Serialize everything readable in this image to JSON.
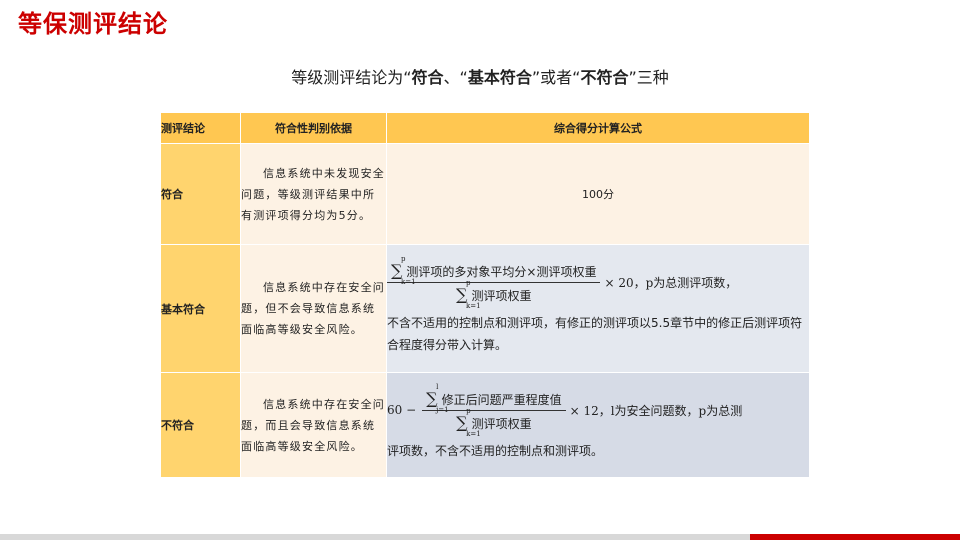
{
  "page": {
    "title": "等保测评结论",
    "subtitle": {
      "prefix": "等级测评结论为“",
      "r1": "符合",
      "sep1": "、“",
      "r2": "基本符合",
      "sep2": "”或者“",
      "r3": "不符合",
      "suffix": "”三种"
    }
  },
  "table": {
    "headers": [
      "测评结论",
      "符合性判别依据",
      "综合得分计算公式"
    ],
    "rows": [
      {
        "conclusion": "符合",
        "basis": "信息系统中未发现安全问题，等级测评结果中所有测评项得分均为5分。",
        "formula": "100分"
      },
      {
        "conclusion": "基本符合",
        "basis": "信息系统中存在安全问题，但不会导致信息系统面临高等级安全风险。",
        "formula": {
          "sum_top": "p",
          "sum_bottom": "k=1",
          "numerator": "测评项的多对象平均分×测评项权重",
          "denominator": "测评项权重",
          "tail": "× 20，p为总测评项数，",
          "note": "不含不适用的控制点和测评项，有修正的测评项以5.5章节中的修正后测评项符合程度得分带入计算。"
        }
      },
      {
        "conclusion": "不符合",
        "basis": "信息系统中存在安全问题，而且会导致信息系统面临高等级安全风险。",
        "formula": {
          "lead": "60 −",
          "num_sum_top": "l",
          "num_sum_bottom": "j=1",
          "numerator": "修正后问题严重程度值",
          "den_sum_top": "p",
          "den_sum_bottom": "k=1",
          "denominator": "测评项权重",
          "tail": "× 12，l为安全问题数，p为总测",
          "note": "评项数，不含不适用的控制点和测评项。"
        }
      }
    ]
  },
  "colors": {
    "title_red": "#cc0000",
    "header_orange": "#ffc751",
    "label_orange": "#ffd46e",
    "basis_cream": "#fdf2e4",
    "formula_blue": "#e4e8ef"
  }
}
